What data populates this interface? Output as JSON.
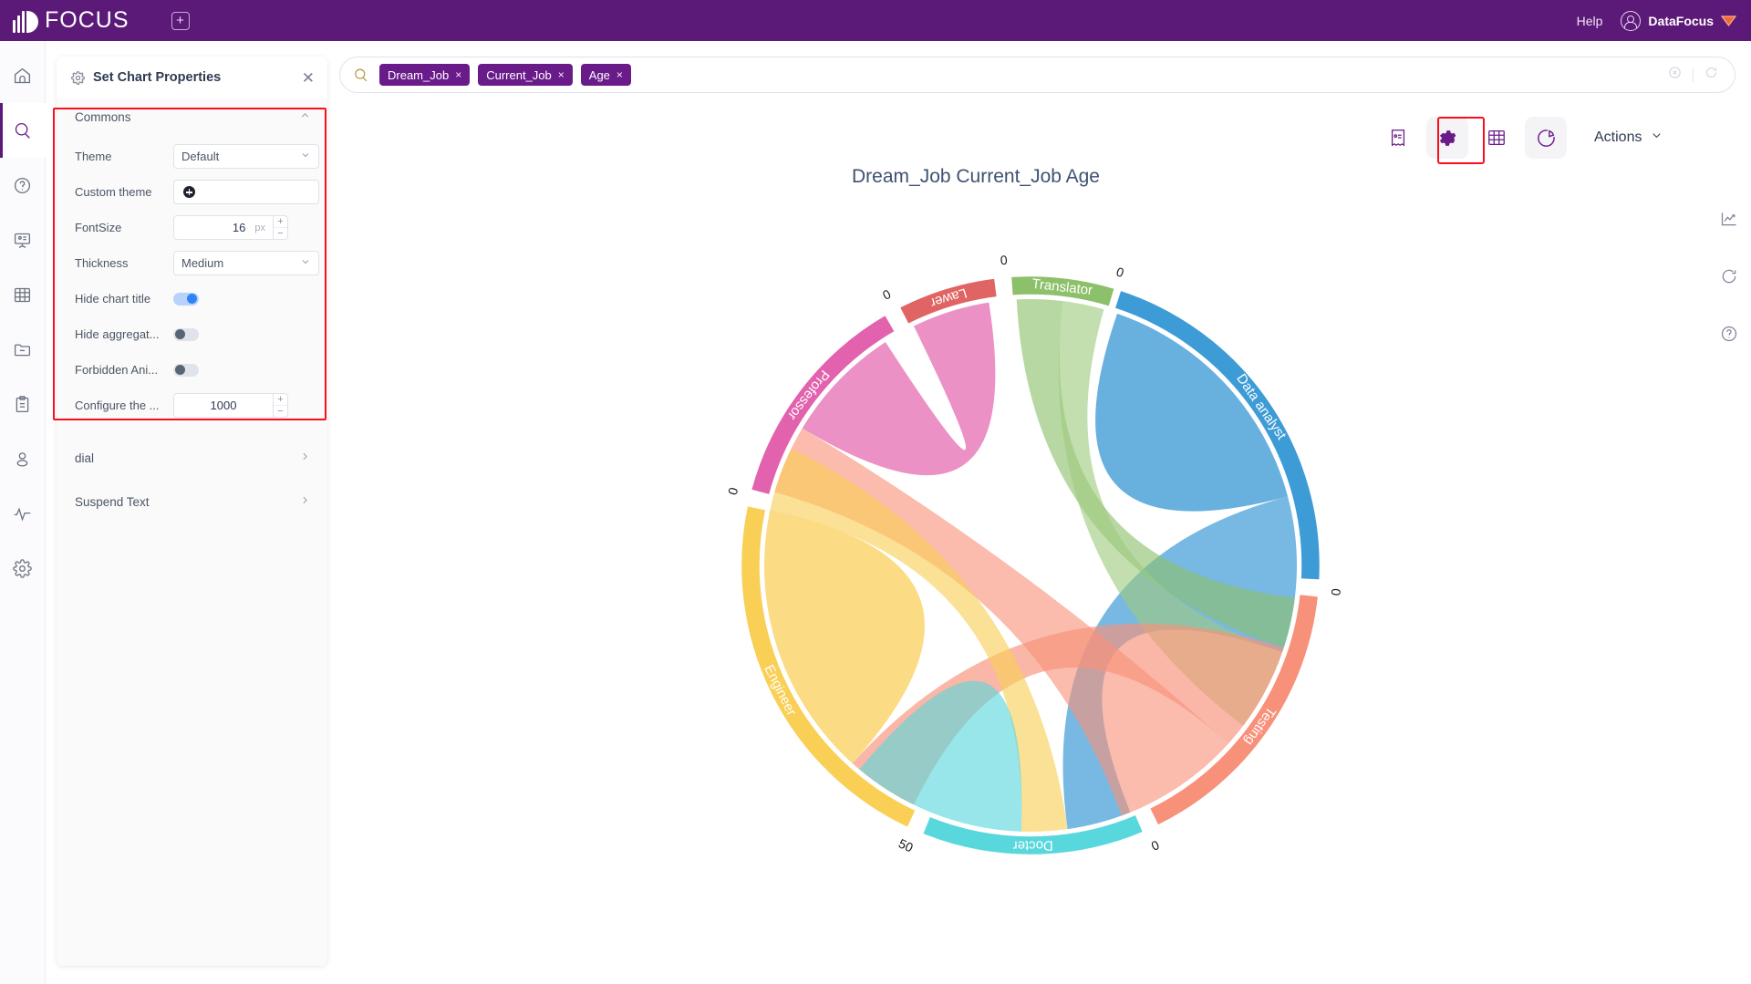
{
  "topbar": {
    "brand": "FOCUS",
    "add_tab_icon": "plus-square-icon",
    "help": "Help",
    "user": "DataFocus"
  },
  "rail": {
    "items": [
      {
        "icon": "home-icon",
        "name": "home",
        "active": false
      },
      {
        "icon": "search-icon",
        "name": "search",
        "active": true
      },
      {
        "icon": "question-circle-icon",
        "name": "help",
        "active": false
      },
      {
        "icon": "presentation-icon",
        "name": "dashboard",
        "active": false
      },
      {
        "icon": "table-grid-icon",
        "name": "data-table",
        "active": false
      },
      {
        "icon": "folder-minus-icon",
        "name": "folder",
        "active": false
      },
      {
        "icon": "clipboard-icon",
        "name": "clipboard",
        "active": false
      },
      {
        "icon": "user-icon",
        "name": "user",
        "active": false
      },
      {
        "icon": "activity-pulse-icon",
        "name": "monitor",
        "active": false
      },
      {
        "icon": "gear-icon",
        "name": "settings",
        "active": false
      }
    ]
  },
  "panel": {
    "title": "Set Chart Properties",
    "gear_icon": "gear-icon",
    "close_icon": "close-icon",
    "section": {
      "label": "Commons",
      "chevron": "chevron-up-icon"
    },
    "rows": {
      "theme": {
        "label": "Theme",
        "value": "Default"
      },
      "custom_theme": {
        "label": "Custom theme",
        "value": ""
      },
      "fontsize": {
        "label": "FontSize",
        "value": "16",
        "unit": "px"
      },
      "thickness": {
        "label": "Thickness",
        "value": "Medium"
      },
      "hide_chart_title": {
        "label": "Hide chart title",
        "state": "on"
      },
      "hide_aggregate": {
        "label": "Hide aggregat...",
        "state": "off"
      },
      "forbidden_animation": {
        "label": "Forbidden Ani...",
        "state": "off"
      },
      "configure": {
        "label": "Configure the ...",
        "value": "1000"
      }
    },
    "accordions": [
      {
        "label": "dial",
        "chevron": "chevron-right-icon"
      },
      {
        "label": "Suspend Text",
        "chevron": "chevron-right-icon"
      }
    ]
  },
  "search": {
    "icon": "search-icon",
    "placeholder": "",
    "tags": [
      {
        "label": "Dream_Job",
        "remove": "×"
      },
      {
        "label": "Current_Job",
        "remove": "×"
      },
      {
        "label": "Age",
        "remove": "×"
      }
    ],
    "clear_icon": "clear-circle-icon",
    "refresh_icon": "refresh-icon"
  },
  "chart_toolbar": {
    "buttons": [
      {
        "name": "receipt-icon",
        "selected": false,
        "shaded": false
      },
      {
        "name": "gear-icon",
        "selected": true,
        "shaded": true
      },
      {
        "name": "table-grid-icon",
        "selected": false,
        "shaded": false
      },
      {
        "name": "pie-chart-icon",
        "selected": false,
        "shaded": true
      }
    ],
    "actions_label": "Actions",
    "actions_chevron": "chevron-down-icon"
  },
  "right_tools": [
    {
      "name": "trend-chart-icon"
    },
    {
      "name": "refresh-icon"
    },
    {
      "name": "question-circle-icon"
    }
  ],
  "chart_data": {
    "type": "chord",
    "title": "Dream_Job Current_Job Age",
    "xlabel": "",
    "ylabel": "",
    "grid": false,
    "legend": "none",
    "tick_labels": [
      "0",
      "0",
      "0",
      "0",
      "0",
      "0",
      "50",
      "0"
    ],
    "axis_range": [
      0,
      50
    ],
    "nodes": [
      {
        "name": "Data analyst",
        "color": "#3d9bd6",
        "start_angle": -72,
        "end_angle": 3,
        "tick": "0"
      },
      {
        "name": "Testing",
        "color": "#f8917a",
        "start_angle": 6,
        "end_angle": 64,
        "tick": "0"
      },
      {
        "name": "Docter",
        "color": "#58d7dd",
        "start_angle": 67,
        "end_angle": 112,
        "tick": "0"
      },
      {
        "name": "Engineer",
        "color": "#f9cf55",
        "start_angle": 115,
        "end_angle": 192,
        "tick": "50"
      },
      {
        "name": "Professor",
        "color": "#e262ad",
        "start_angle": 195,
        "end_angle": 240,
        "tick": "0"
      },
      {
        "name": "Lawer",
        "color": "#e06464",
        "start_angle": 243,
        "end_angle": 263,
        "tick": "0"
      },
      {
        "name": "Translator",
        "color": "#8dc06a",
        "start_angle": 266,
        "end_angle": 287,
        "tick": "0"
      }
    ],
    "links": [
      {
        "source": "Data analyst",
        "target": "Data analyst",
        "value": 0,
        "color": "#3d9bd6"
      },
      {
        "source": "Data analyst",
        "target": "Docter",
        "value": 0,
        "color": "#3d9bd6"
      },
      {
        "source": "Translator",
        "target": "Testing",
        "value": 0,
        "color": "#8dc06a"
      },
      {
        "source": "Translator",
        "target": "Translator",
        "value": 0,
        "color": "#8dc06a"
      },
      {
        "source": "Testing",
        "target": "Engineer",
        "value": 0,
        "color": "#f8917a"
      },
      {
        "source": "Testing",
        "target": "Professor",
        "value": 0,
        "color": "#f8917a"
      },
      {
        "source": "Engineer",
        "target": "Engineer",
        "value": 50,
        "color": "#f9cf55"
      },
      {
        "source": "Engineer",
        "target": "Docter",
        "value": 0,
        "color": "#f9cf55"
      },
      {
        "source": "Professor",
        "target": "Lawer",
        "value": 0,
        "color": "#e262ad"
      },
      {
        "source": "Docter",
        "target": "Docter",
        "value": 0,
        "color": "#58d7dd"
      }
    ]
  }
}
